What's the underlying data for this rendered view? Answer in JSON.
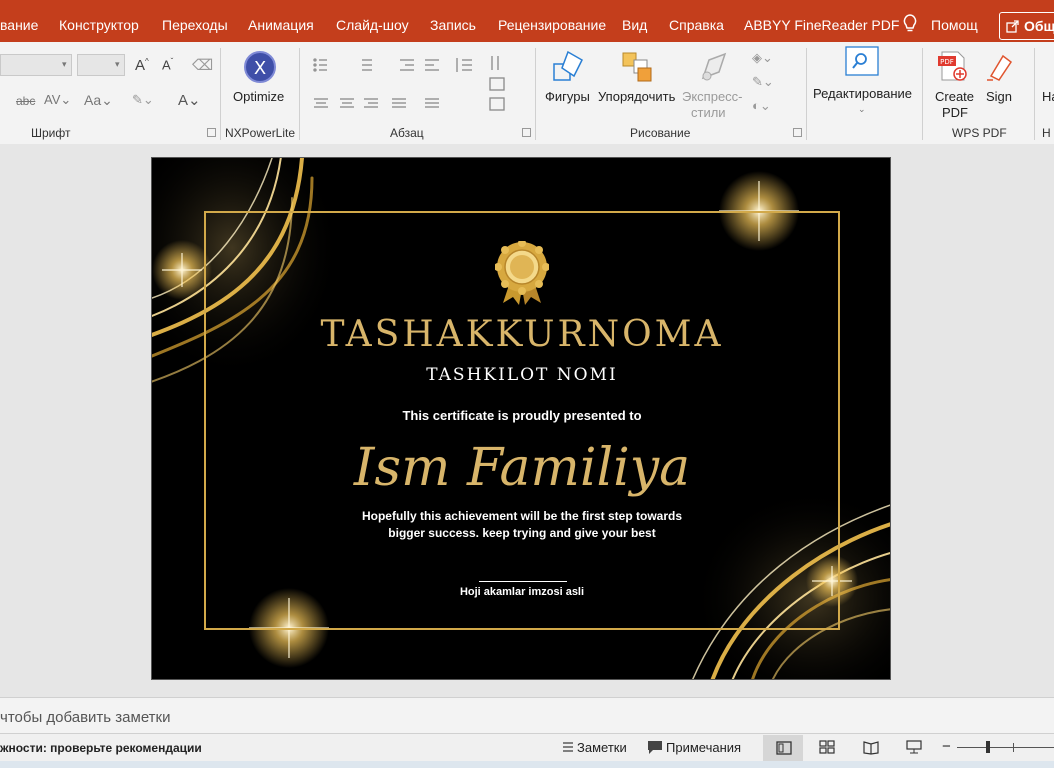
{
  "tabs": [
    "вание",
    "Конструктор",
    "Переходы",
    "Анимация",
    "Слайд-шоу",
    "Запись",
    "Рецензирование",
    "Вид",
    "Справка",
    "ABBYY FineReader PDF",
    "Помощ"
  ],
  "share_label": "Общ",
  "ribbon": {
    "groups": {
      "font": "Шрифт",
      "nxpowerlite": "NXPowerLite",
      "paragraph": "Абзац",
      "drawing": "Рисование",
      "wps_pdf": "WPS PDF",
      "cut_off": "Н"
    },
    "buttons": {
      "optimize": "Optimize",
      "shapes": "Фигуры",
      "arrange": "Упорядочить",
      "express_1": "Экспресс-",
      "express_2": "стили",
      "editing": "Редактирование",
      "create_pdf_1": "Create",
      "create_pdf_2": "PDF",
      "sign": "Sign",
      "cut_off": "На"
    },
    "pdf_badge": "PDF",
    "abc_label": "abc"
  },
  "certificate": {
    "title": "TASHAKKURNOMA",
    "organization": "TASHKILOT NOMI",
    "presented_to": "This certificate is proudly presented to",
    "recipient": "Ism Familiya",
    "message_1": "Hopefully this achievement will be the first step towards",
    "message_2": "bigger success. keep trying and give your best",
    "signature": "Hoji akamlar imzosi asli"
  },
  "notes_placeholder": "чтобы добавить заметки",
  "status": {
    "accessibility": "жности: проверьте рекомендации",
    "notes_button": "Заметки",
    "comments_button": "Примечания",
    "zoom_minus": "−"
  },
  "colors": {
    "ribbon_accent": "#c43e1c",
    "gold": "#d8b56a",
    "slide_bg": "#000000"
  },
  "icons": [
    "lightbulb-icon",
    "share-icon",
    "optimize-icon",
    "shapes-icon",
    "arrange-icon",
    "quick-styles-icon",
    "find-icon",
    "create-pdf-icon",
    "sign-icon",
    "medal-icon",
    "notes-icon",
    "comments-icon",
    "normal-view-icon",
    "slide-sorter-icon",
    "reading-view-icon",
    "slideshow-icon"
  ]
}
